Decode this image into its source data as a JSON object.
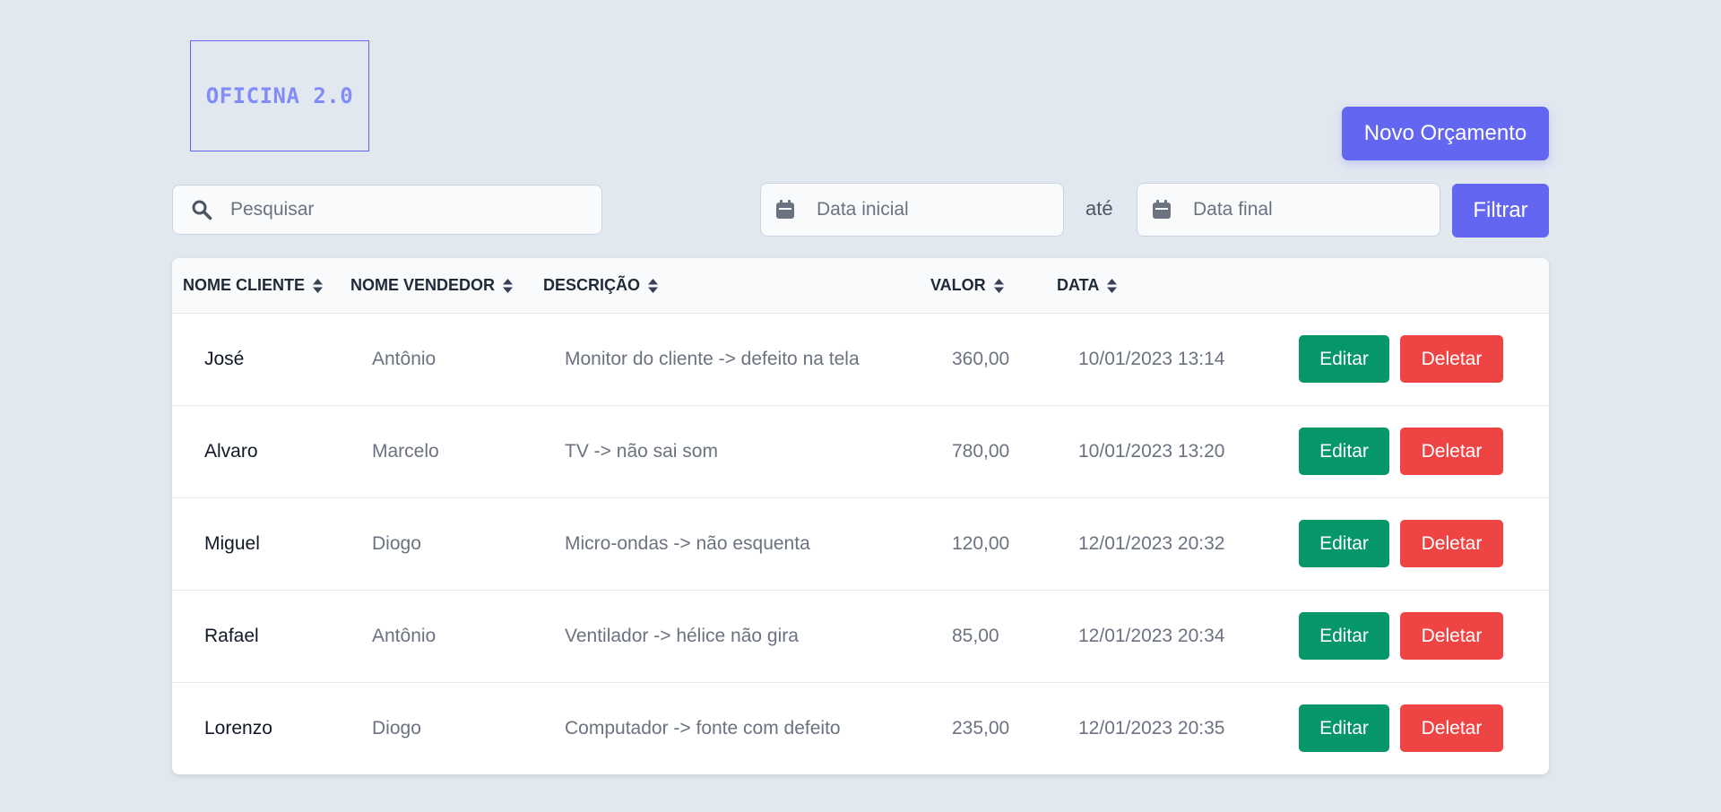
{
  "logo": {
    "text": "OFICINA 2.0"
  },
  "toolbar": {
    "new_label": "Novo Orçamento",
    "search_placeholder": "Pesquisar",
    "date_start_placeholder": "Data inicial",
    "date_separator": "até",
    "date_end_placeholder": "Data final",
    "filter_label": "Filtrar"
  },
  "table": {
    "headers": [
      "NOME CLIENTE",
      "NOME VENDEDOR",
      "DESCRIÇÃO",
      "VALOR",
      "DATA"
    ],
    "rows": [
      {
        "cliente": "José",
        "vendedor": "Antônio",
        "descricao": "Monitor do cliente -> defeito na tela",
        "valor": "360,00",
        "data": "10/01/2023 13:14"
      },
      {
        "cliente": "Alvaro",
        "vendedor": "Marcelo",
        "descricao": "TV -> não sai som",
        "valor": "780,00",
        "data": "10/01/2023 13:20"
      },
      {
        "cliente": "Miguel",
        "vendedor": "Diogo",
        "descricao": "Micro-ondas -> não esquenta",
        "valor": "120,00",
        "data": "12/01/2023 20:32"
      },
      {
        "cliente": "Rafael",
        "vendedor": "Antônio",
        "descricao": "Ventilador -> hélice não gira",
        "valor": "85,00",
        "data": "12/01/2023 20:34"
      },
      {
        "cliente": "Lorenzo",
        "vendedor": "Diogo",
        "descricao": "Computador -> fonte com defeito",
        "valor": "235,00",
        "data": "12/01/2023 20:35"
      }
    ],
    "edit_label": "Editar",
    "delete_label": "Deletar"
  },
  "icons": {
    "search": "search-icon",
    "calendar": "calendar-icon",
    "sort": "sort-icon"
  },
  "colors": {
    "primary": "#6366f1",
    "edit": "#059669",
    "delete": "#ef4444",
    "background": "#e2e8f0"
  }
}
